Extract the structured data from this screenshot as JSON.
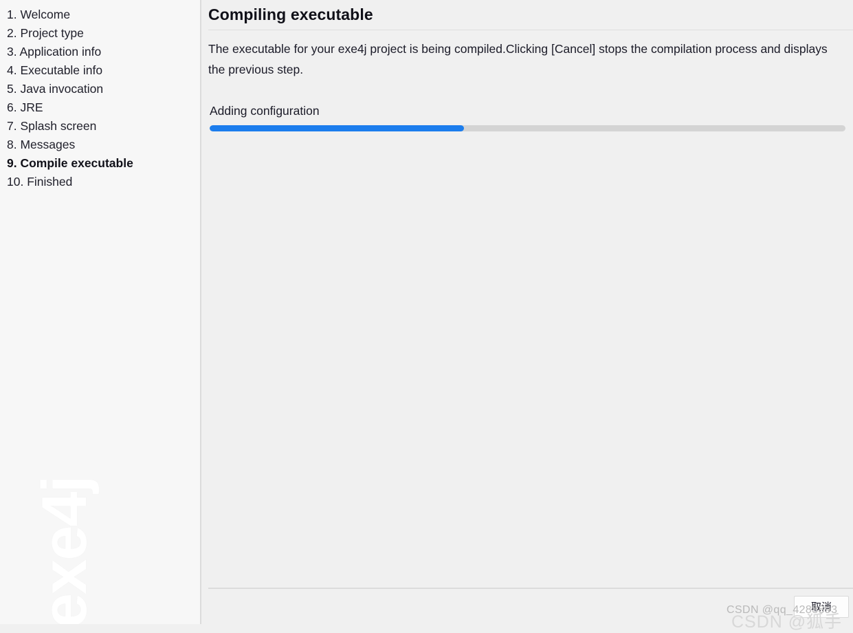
{
  "sidebar": {
    "watermark": "exe4j",
    "steps": [
      {
        "label": "1. Welcome",
        "current": false
      },
      {
        "label": "2. Project type",
        "current": false
      },
      {
        "label": "3. Application info",
        "current": false
      },
      {
        "label": "4. Executable info",
        "current": false
      },
      {
        "label": "5. Java invocation",
        "current": false
      },
      {
        "label": "6. JRE",
        "current": false
      },
      {
        "label": "7. Splash screen",
        "current": false
      },
      {
        "label": "8. Messages",
        "current": false
      },
      {
        "label": "9. Compile executable",
        "current": true
      },
      {
        "label": "10. Finished",
        "current": false
      }
    ]
  },
  "main": {
    "title": "Compiling executable",
    "description": "The executable for your exe4j project is being compiled.Clicking [Cancel] stops the compilation process and displays the previous step.",
    "progress": {
      "label": "Adding configuration",
      "percent": 40,
      "fill_color": "#1c7ded",
      "track_color": "#d4d4d4"
    }
  },
  "footer": {
    "cancel_label": "取消"
  },
  "watermarks": {
    "small": "CSDN @qq_4288893",
    "large": "CSDN @狐手"
  }
}
